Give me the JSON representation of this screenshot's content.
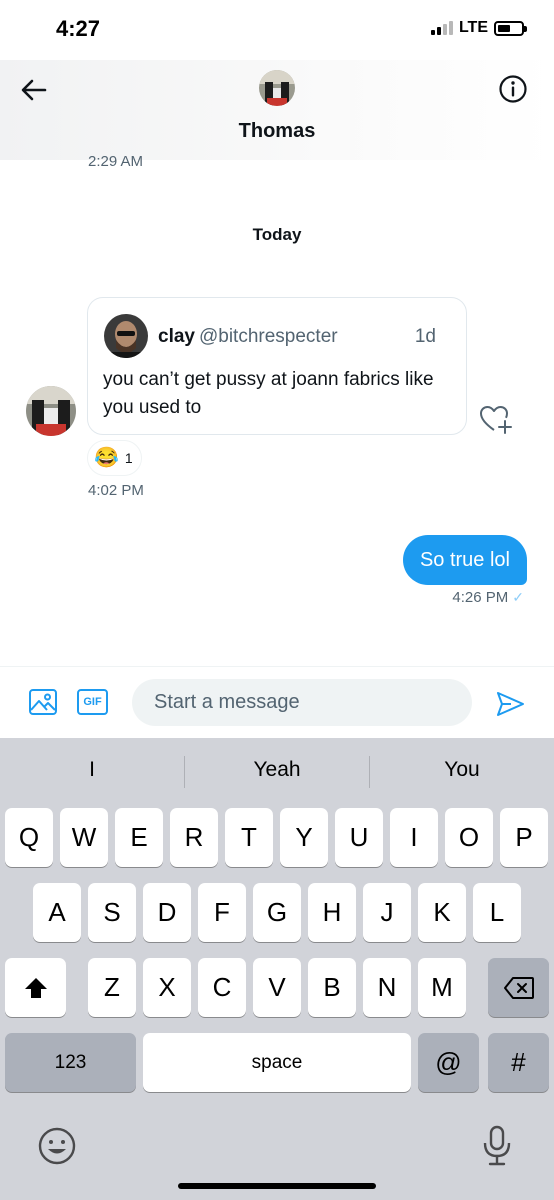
{
  "status_bar": {
    "time": "4:27",
    "network": "LTE"
  },
  "header": {
    "contact_name": "Thomas"
  },
  "conversation": {
    "earlier_timestamp": "2:29 AM",
    "day_divider": "Today",
    "received": {
      "tweet": {
        "author_name": "clay",
        "author_handle": "@bitchrespecter",
        "age": "1d",
        "text": "you can’t get pussy at joann fabrics like you used to"
      },
      "reaction": {
        "emoji": "😂",
        "count": "1"
      },
      "timestamp": "4:02 PM"
    },
    "sent": {
      "text": "So true lol",
      "timestamp": "4:26 PM"
    }
  },
  "composer": {
    "gif_label": "GIF",
    "placeholder": "Start a message"
  },
  "keyboard": {
    "suggestions": [
      "I",
      "Yeah",
      "You"
    ],
    "row1": [
      "Q",
      "W",
      "E",
      "R",
      "T",
      "Y",
      "U",
      "I",
      "O",
      "P"
    ],
    "row2": [
      "A",
      "S",
      "D",
      "F",
      "G",
      "H",
      "J",
      "K",
      "L"
    ],
    "row3": [
      "Z",
      "X",
      "C",
      "V",
      "B",
      "N",
      "M"
    ],
    "numbers_label": "123",
    "space_label": "space",
    "at_label": "@",
    "hash_label": "#"
  },
  "colors": {
    "accent": "#1d9bf0",
    "keyboard_bg": "#d1d3d9"
  }
}
